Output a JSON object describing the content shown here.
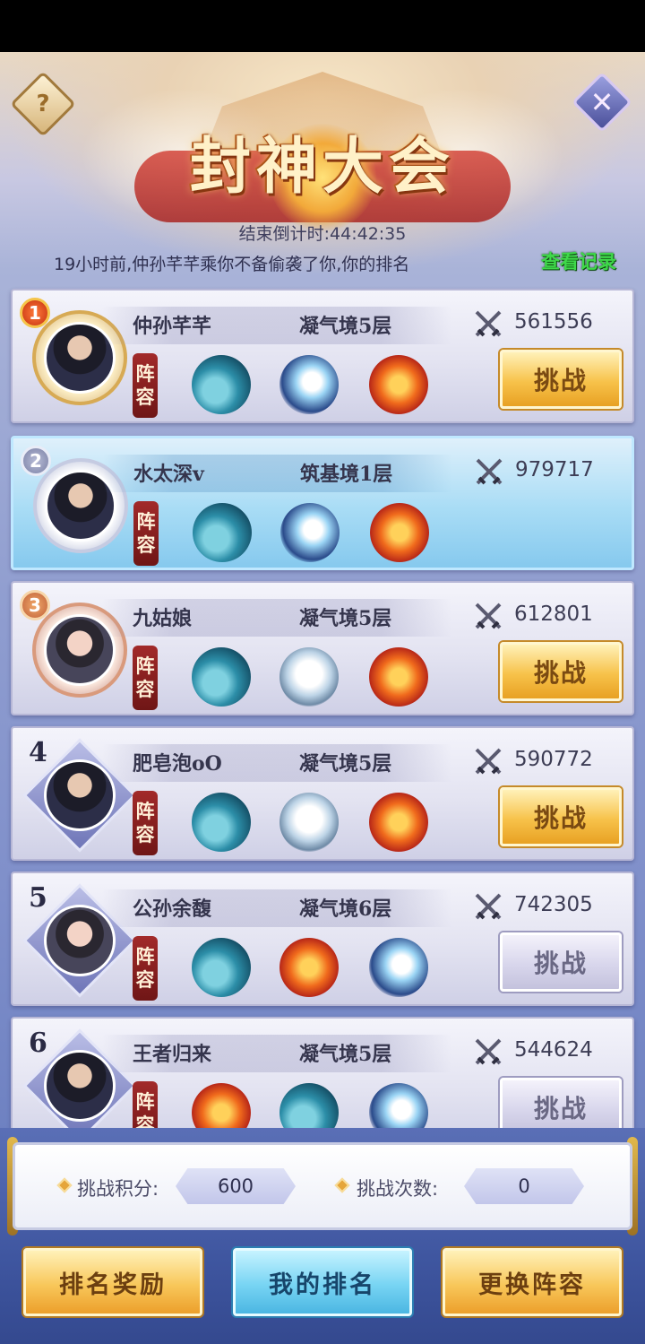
{
  "header": {
    "title": "封神大会",
    "countdown": "结束倒计时:44:42:35",
    "notice": "19小时前,仲孙芊芊乘你不备偷袭了你,你的排名",
    "record_link": "查看记录",
    "help_symbol": "?",
    "close_symbol": "✕"
  },
  "lineup_label": [
    "阵",
    "容"
  ],
  "challenge_label": "挑战",
  "players": [
    {
      "rank": "1",
      "name": "仲孙芊芊",
      "realm": "凝气境5层",
      "power": "561556",
      "pets": [
        "whale-icon",
        "dragon-blue-icon",
        "dragon-fire-icon"
      ],
      "challenge": "active"
    },
    {
      "rank": "2",
      "name": "水太深v",
      "realm": "筑基境1层",
      "power": "979717",
      "pets": [
        "whale-icon",
        "dragon-blue-icon",
        "dragon-fire-icon"
      ],
      "challenge": "none"
    },
    {
      "rank": "3",
      "name": "九姑娘",
      "realm": "凝气境5层",
      "power": "612801",
      "pets": [
        "whale-icon",
        "tiger-icon",
        "dragon-fire-icon"
      ],
      "challenge": "active"
    },
    {
      "rank": "4",
      "name": "肥皂泡oO",
      "realm": "凝气境5层",
      "power": "590772",
      "pets": [
        "whale-icon",
        "tiger-icon",
        "dragon-fire-icon"
      ],
      "challenge": "active"
    },
    {
      "rank": "5",
      "name": "公孙余馥",
      "realm": "凝气境6层",
      "power": "742305",
      "pets": [
        "whale-icon",
        "dragon-fire-icon",
        "dragon-blue-icon"
      ],
      "challenge": "disabled"
    },
    {
      "rank": "6",
      "name": "王者归来",
      "realm": "凝气境5层",
      "power": "544624",
      "pets": [
        "dragon-fire-icon",
        "whale-icon",
        "dragon-blue-icon"
      ],
      "challenge": "disabled"
    }
  ],
  "stats": {
    "points_label": "挑战积分:",
    "points_value": "600",
    "attempts_label": "挑战次数:",
    "attempts_value": "0"
  },
  "actions": {
    "reward": "排名奖励",
    "my_rank": "我的排名",
    "lineup": "更换阵容"
  },
  "colors": {
    "gold_button": "#f7c24a",
    "blue_button": "#77d4f3",
    "record_link": "#3fd84a",
    "lineup_tag": "#a22a2a"
  }
}
